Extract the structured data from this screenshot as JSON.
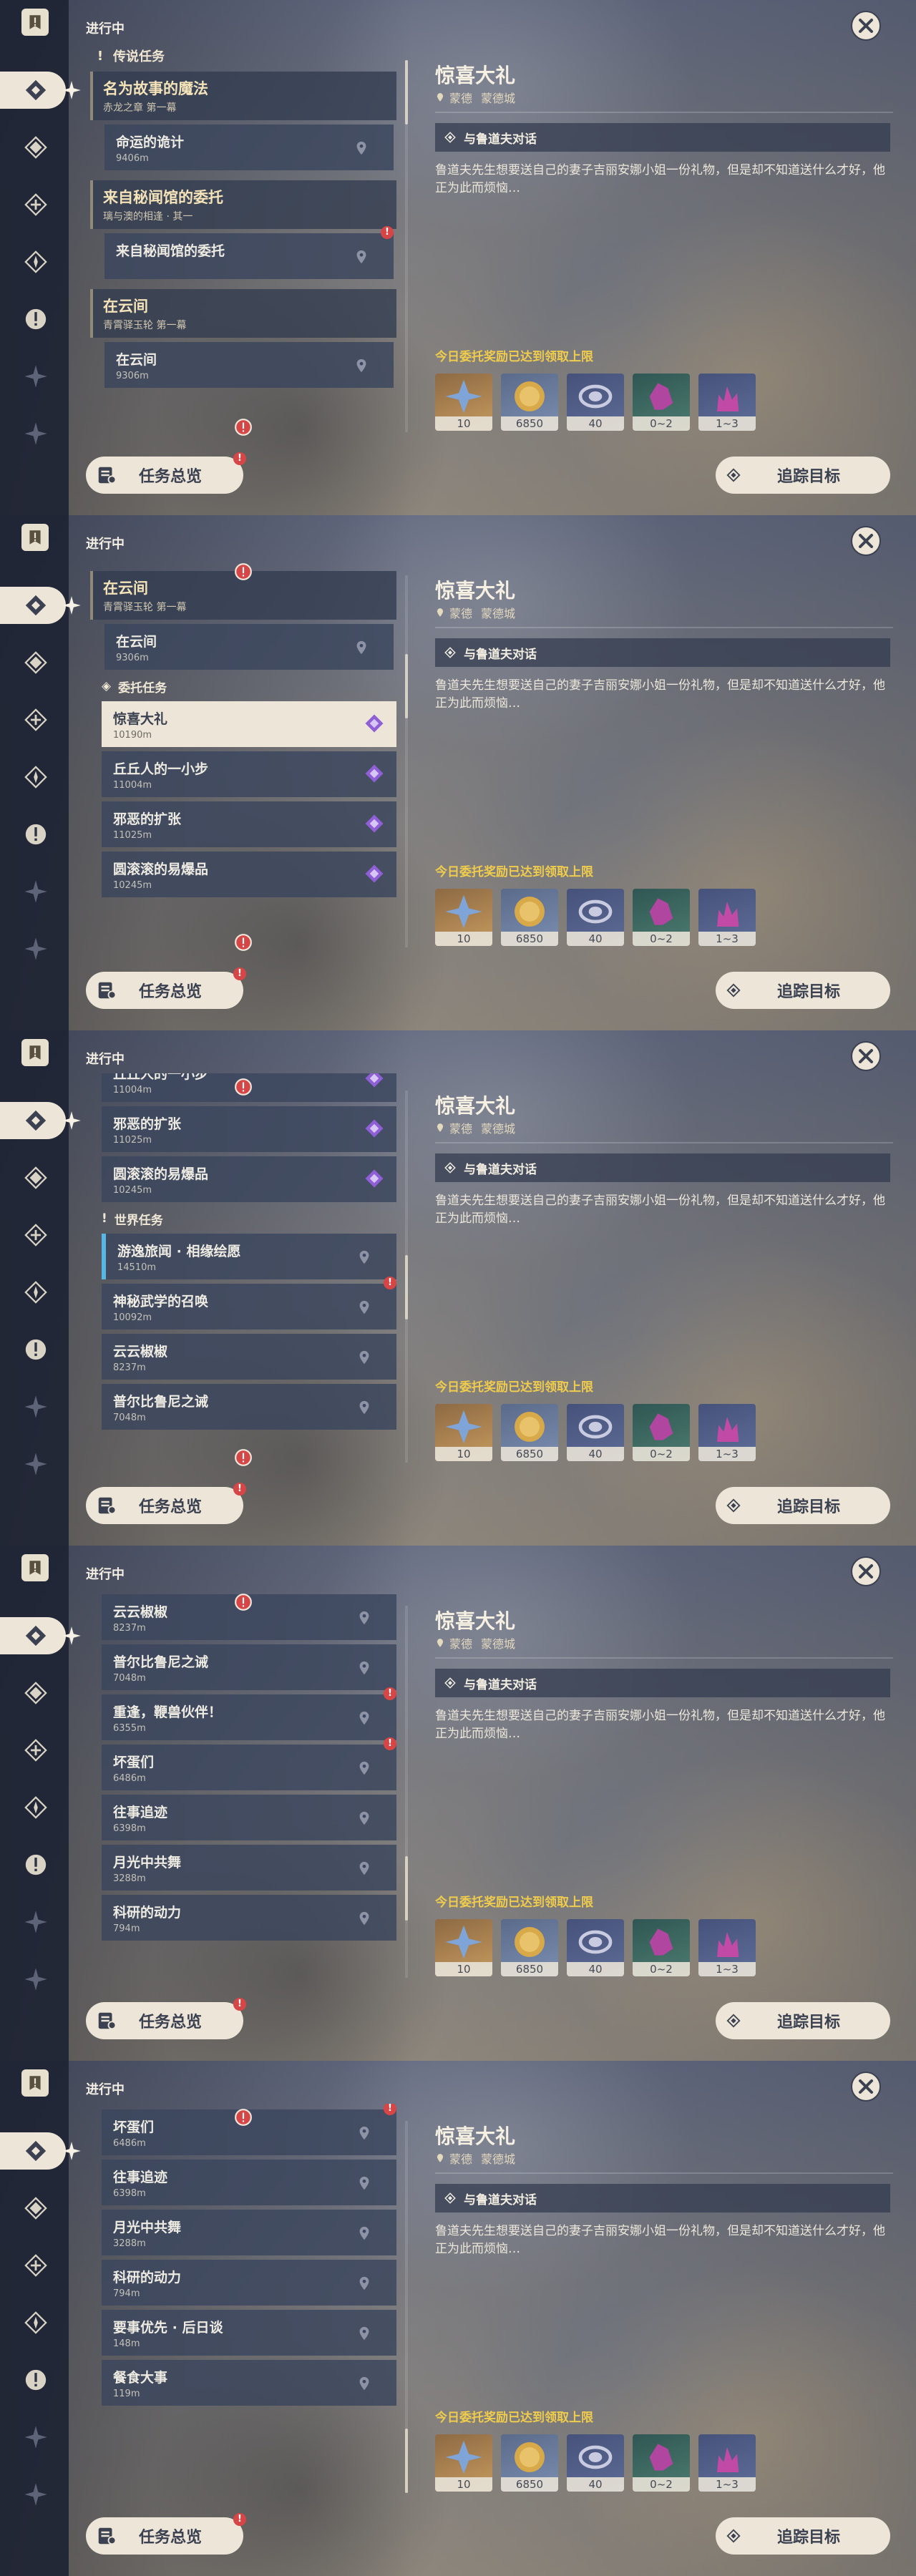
{
  "header": {
    "title": "进行中"
  },
  "sections": {
    "legend": "传说任务",
    "commission": "委托任务",
    "world": "世界任务"
  },
  "legend_groups": [
    {
      "title": "名为故事的魔法",
      "subtitle": "赤龙之章 第一幕",
      "quest": {
        "title": "命运的诡计",
        "distance": "9406m"
      }
    },
    {
      "title": "来自秘闻馆的委托",
      "subtitle": "璃与澳的相逢 · 其一",
      "quest": {
        "title": "来自秘闻馆的委托",
        "distance": ""
      }
    },
    {
      "title": "在云间",
      "subtitle": "青霄驿玉轮 第一幕",
      "quest": {
        "title": "在云间",
        "distance": "9306m"
      }
    }
  ],
  "commissions": [
    {
      "title": "惊喜大礼",
      "distance": "10190m"
    },
    {
      "title": "丘丘人的一小步",
      "distance": "11004m"
    },
    {
      "title": "邪恶的扩张",
      "distance": "11025m"
    },
    {
      "title": "圆滚滚的易爆品",
      "distance": "10245m"
    }
  ],
  "world_quests": [
    {
      "title": "游逸旅闻 · 相缘绘愿",
      "distance": "14510m"
    },
    {
      "title": "神秘武学的召唤",
      "distance": "10092m"
    },
    {
      "title": "云云椒椒",
      "distance": "8237m"
    },
    {
      "title": "普尔比鲁尼之诫",
      "distance": "7048m"
    },
    {
      "title": "重逢，鞭兽伙伴！",
      "distance": "6355m"
    },
    {
      "title": "坏蛋们",
      "distance": "6486m"
    },
    {
      "title": "往事追迹",
      "distance": "6398m"
    },
    {
      "title": "月光中共舞",
      "distance": "3288m"
    },
    {
      "title": "科研的动力",
      "distance": "794m"
    },
    {
      "title": "要事优先 · 后日谈",
      "distance": "148m"
    },
    {
      "title": "餐食大事",
      "distance": "119m"
    }
  ],
  "detail": {
    "title": "惊喜大礼",
    "region": "蒙德",
    "city": "蒙德城",
    "step": "与鲁道夫对话",
    "description": "鲁道夫先生想要送自己的妻子吉丽安娜小姐一份礼物，但是却不知道送什么才好，他正为此而烦恼…",
    "reward_note": "今日委托奖励已达到领取上限",
    "rewards": [
      {
        "name": "adventure-exp",
        "count": "10"
      },
      {
        "name": "mora",
        "count": "6850"
      },
      {
        "name": "companionship-exp",
        "count": "40"
      },
      {
        "name": "crystal-chunk",
        "count": "0~2"
      },
      {
        "name": "crystal-ore",
        "count": "1~3"
      }
    ]
  },
  "buttons": {
    "overview": "任务总览",
    "track": "追踪目标"
  },
  "colors": {
    "accent": "#f0cc4d",
    "alert": "#d64646",
    "panel": "#ece5d8",
    "world_accent": "#59b6e3"
  }
}
